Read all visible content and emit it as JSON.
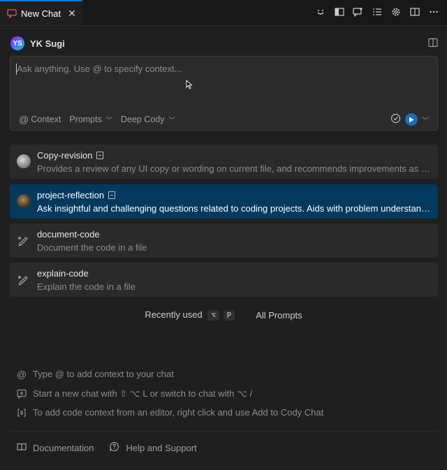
{
  "tab": {
    "title": "New Chat",
    "close": "✕"
  },
  "user": {
    "initials": "YS",
    "name": "YK Sugi"
  },
  "input": {
    "placeholder": "Ask anything. Use @ to specify context...",
    "context_label": "Context",
    "prompts_label": "Prompts",
    "model_label": "Deep Cody"
  },
  "prompts": [
    {
      "title": "Copy-revision",
      "description": "Provides a review of any UI copy or wording on current file, and recommends improvements as needed.",
      "icon": "user-avatar"
    },
    {
      "title": "project-reflection",
      "description": "Ask insightful and challenging questions related to coding projects. Aids with problem understanding and solution design.",
      "icon": "user-avatar"
    },
    {
      "title": "document-code",
      "description": "Document the code in a file",
      "icon": "pencil-sparkle-icon"
    },
    {
      "title": "explain-code",
      "description": "Explain the code in a file",
      "icon": "pencil-sparkle-icon"
    }
  ],
  "recent": {
    "label": "Recently used",
    "key1": "⌥",
    "key2": "P",
    "all_label": "All Prompts"
  },
  "hints": [
    {
      "icon": "at-icon",
      "text": "Type @ to add context to your chat"
    },
    {
      "icon": "new-chat-icon",
      "text": "Start a new chat with ⇧ ⌥ L or switch to chat with ⌥ /"
    },
    {
      "icon": "code-context-icon",
      "text": "To add code context from an editor, right click and use Add to Cody Chat"
    }
  ],
  "footer": {
    "documentation": "Documentation",
    "help": "Help and Support"
  },
  "colors": {
    "accent": "#0078d4",
    "selected": "#04395e",
    "send": "#1a6db3"
  }
}
